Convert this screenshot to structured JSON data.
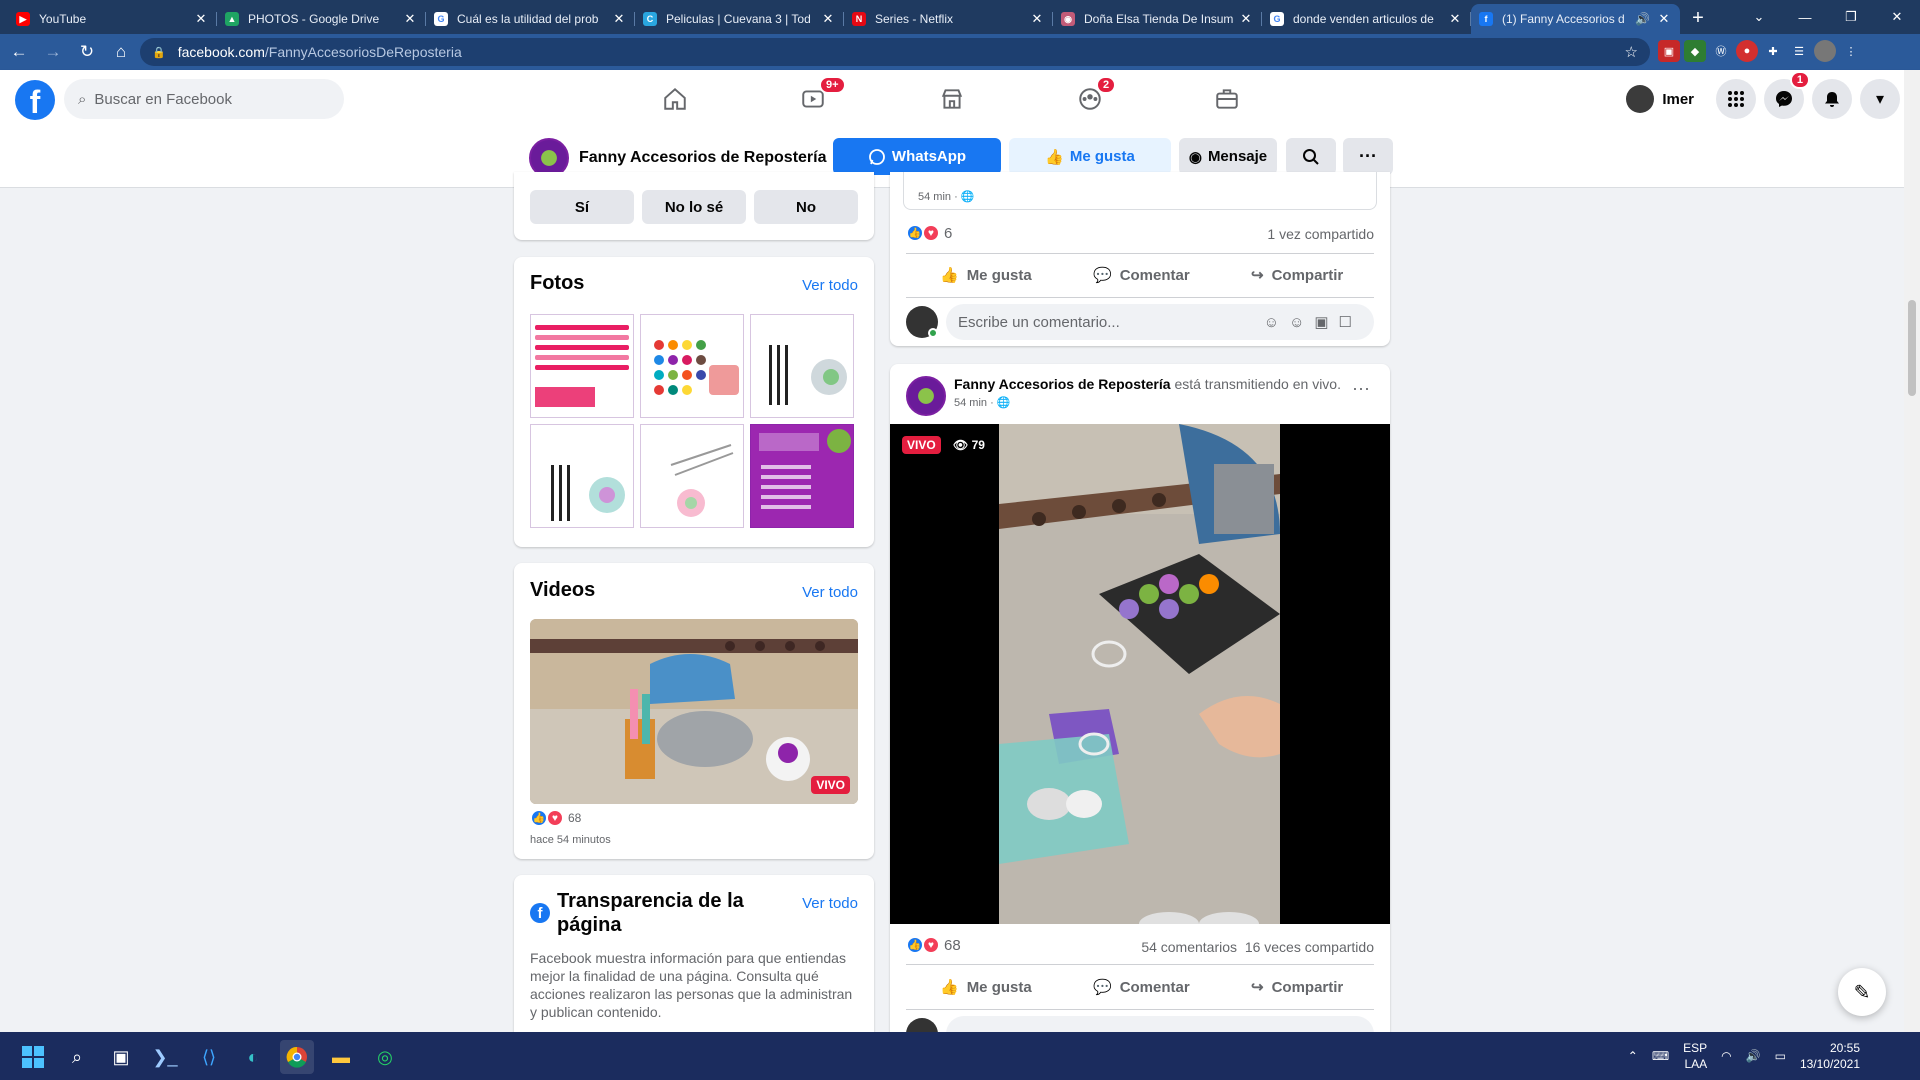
{
  "browser": {
    "tabs": [
      {
        "title": "YouTube",
        "fav": "youtube-favicon",
        "color": "#ff0000",
        "glyph": "▶"
      },
      {
        "title": "PHOTOS - Google Drive",
        "fav": "google-drive-favicon",
        "color": "#1fa463",
        "glyph": "▲"
      },
      {
        "title": "Cuál es la utilidad del prob",
        "fav": "google-favicon",
        "color": "#ffffff",
        "glyph": "G"
      },
      {
        "title": "Peliculas | Cuevana 3 | Tod",
        "fav": "cuevana-favicon",
        "color": "#2aa6e0",
        "glyph": "C"
      },
      {
        "title": "Series - Netflix",
        "fav": "netflix-favicon",
        "color": "#e50914",
        "glyph": "N"
      },
      {
        "title": "Doña Elsa Tienda De Insum",
        "fav": "store-favicon",
        "color": "#c25b78",
        "glyph": "◉"
      },
      {
        "title": "donde venden articulos de",
        "fav": "google-favicon",
        "color": "#ffffff",
        "glyph": "G"
      },
      {
        "title": "(1) Fanny Accesorios d",
        "fav": "facebook-favicon",
        "color": "#1877f2",
        "glyph": "f"
      }
    ],
    "url_domain": "facebook.com",
    "url_path": "/FannyAccesoriosDeReposteria"
  },
  "fb": {
    "search_placeholder": "Buscar en Facebook",
    "watch_badge": "9+",
    "groups_badge": "2",
    "user_name": "Imer",
    "messenger_badge": "1"
  },
  "page": {
    "name": "Fanny Accesorios de Repostería",
    "whatsapp_label": "WhatsApp",
    "like_label": "Me gusta",
    "message_label": "Mensaje"
  },
  "poll": {
    "options": [
      "Sí",
      "No lo sé",
      "No"
    ]
  },
  "photos": {
    "title": "Fotos",
    "see_all": "Ver todo"
  },
  "videos": {
    "title": "Videos",
    "see_all": "Ver todo",
    "live_label": "VIVO",
    "reactions": "68",
    "time": "hace 54 minutos"
  },
  "transparency": {
    "title": "Transparencia de la página",
    "see_all": "Ver todo",
    "body": "Facebook muestra información para que entiendas mejor la finalidad de una página. Consulta qué acciones realizaron las personas que la administran y publican contenido."
  },
  "post1": {
    "time": "54 min ·",
    "reactions": "6",
    "shares": "1 vez compartido",
    "like": "Me gusta",
    "comment": "Comentar",
    "share": "Compartir",
    "comment_placeholder": "Escribe un comentario..."
  },
  "post2": {
    "author": "Fanny Accesorios de Repostería",
    "status": "está transmitiendo en vivo.",
    "time": "54 min ·",
    "live_label": "VIVO",
    "viewers": "79",
    "reactions": "68",
    "comments": "54 comentarios",
    "shares": "16 veces compartido",
    "like": "Me gusta",
    "comment": "Comentar",
    "share": "Compartir"
  },
  "taskbar": {
    "lang1": "ESP",
    "lang2": "LAA",
    "time": "20:55",
    "date": "13/10/2021"
  }
}
